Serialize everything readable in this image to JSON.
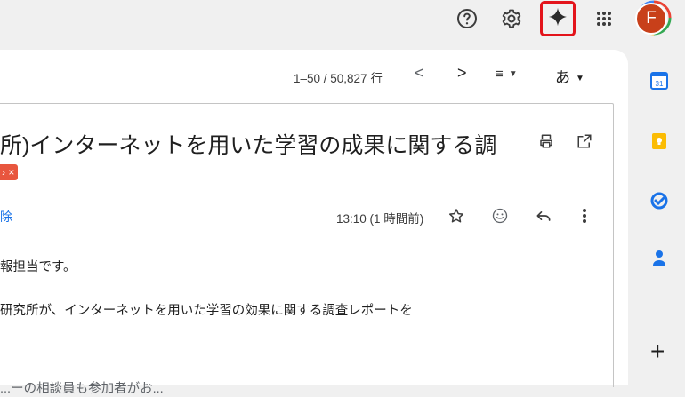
{
  "topbar": {
    "help_icon": "help-circle-icon",
    "settings_icon": "gear-icon",
    "gemini_icon": "gemini-sparkle-icon",
    "apps_icon": "apps-grid-icon",
    "avatar_letter": "F",
    "gemini_highlight_color": "#e3141b"
  },
  "toolbar": {
    "pager": "1–50 / 50,827 行",
    "prev": "<",
    "next": ">",
    "split_icon": "≡",
    "lang": "あ"
  },
  "message": {
    "subject": "所)インターネットを用いた学習の成果に関する調",
    "label_chip": "› ×",
    "unsubscribe": "除",
    "time": "13:10 (1 時間前)",
    "body_lines": [
      "報担当です。",
      "研究所が、インターネットを用いた学習の効果に関する調査レポートを",
      "...ーの相談員も参加者がお..."
    ]
  },
  "side_panel": {
    "calendar_day": "31",
    "add": "+"
  },
  "colors": {
    "page_bg": "#f0f0f0",
    "card_bg": "#ffffff",
    "link": "#1a73e8",
    "avatar": "#c8401a",
    "keep": "#fbbc04",
    "tasks": "#1a73e8",
    "contacts": "#1a73e8"
  }
}
